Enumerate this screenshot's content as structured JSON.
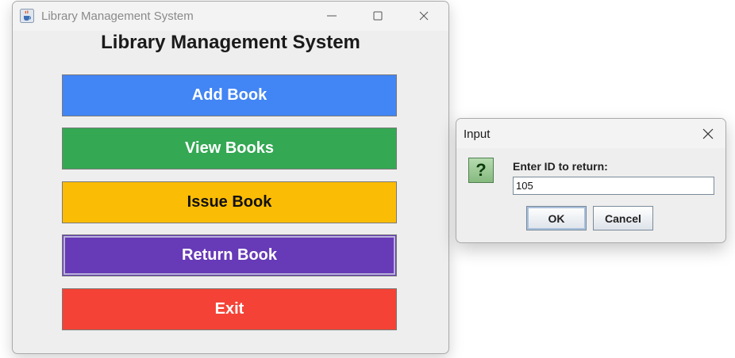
{
  "main_window": {
    "title": "Library Management System",
    "heading": "Library Management System",
    "buttons": {
      "add_book": "Add Book",
      "view_books": "View Books",
      "issue_book": "Issue Book",
      "return_book": "Return Book",
      "exit": "Exit"
    },
    "controls": [
      "minimize-icon",
      "maximize-icon",
      "close-icon"
    ],
    "icon": "java-cup-icon"
  },
  "dialog": {
    "title": "Input",
    "prompt": "Enter ID to return:",
    "input_value": "105",
    "ok_label": "OK",
    "cancel_label": "Cancel",
    "icon": "question-icon",
    "icon_glyph": "?"
  },
  "colors": {
    "add_book": "#4285f4",
    "view_books": "#34a853",
    "issue_book": "#fbbc05",
    "return_book": "#673ab7",
    "exit": "#f44336"
  }
}
